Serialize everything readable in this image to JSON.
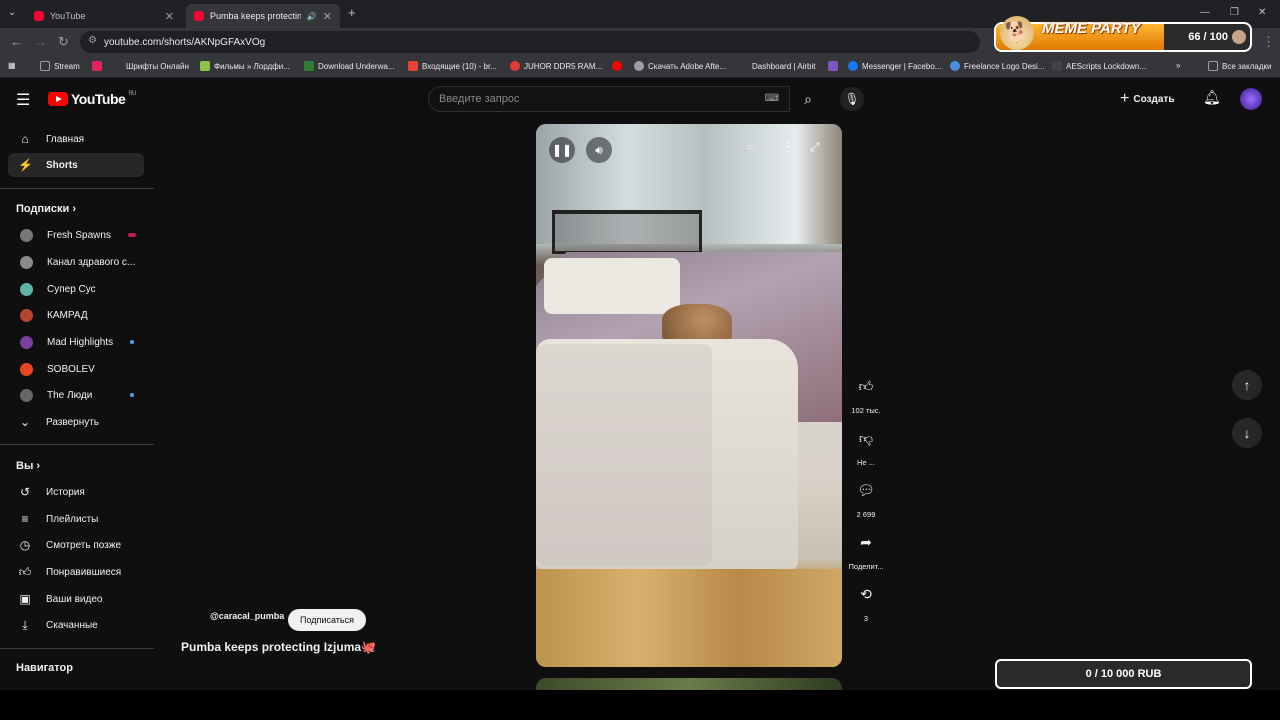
{
  "browser": {
    "tabs": [
      {
        "label": "YouTube"
      },
      {
        "label": "Pumba keeps protecting Iz"
      }
    ],
    "url": "youtube.com/shorts/AKNpGFAxVOg",
    "bookmarks": [
      {
        "label": "Stream",
        "color": "#5f6368"
      },
      {
        "label": "",
        "color": "#e0245e"
      },
      {
        "label": "Шрифты Онлайн",
        "color": "#5f6368"
      },
      {
        "label": "Фильмы » Лордфи...",
        "color": "#8bc34a"
      },
      {
        "label": "Download Underwa...",
        "color": "#2e7d32"
      },
      {
        "label": "Входящие (10) - br...",
        "color": "#ea4335"
      },
      {
        "label": "JUHOR DDR5 RAM...",
        "color": "#e53935"
      },
      {
        "label": "",
        "color": "#ff0000"
      },
      {
        "label": "Скачать Adobe Afte...",
        "color": "#9e9e9e"
      },
      {
        "label": "Dashboard | Airbit",
        "color": "#35363a"
      },
      {
        "label": "",
        "color": "#7e57c2"
      },
      {
        "label": "Messenger | Facebo...",
        "color": "#1877f2"
      },
      {
        "label": "Freelance Logo Desi...",
        "color": "#4a90d9"
      },
      {
        "label": "AEScripts Lockdown...",
        "color": "#424242"
      }
    ],
    "all_bookmarks": "Все закладки"
  },
  "meme_widget": {
    "title": "MEME PARTY",
    "count": "66 / 100",
    "progress": 0.66
  },
  "youtube": {
    "region": "RU",
    "logo_text": "YouTube",
    "search_placeholder": "Введите запрос",
    "create_label": "Создать"
  },
  "sidebar": {
    "main": [
      {
        "label": "Главная",
        "icon": "home-icon"
      },
      {
        "label": "Shorts",
        "icon": "shorts-icon",
        "selected": true
      }
    ],
    "subs_heading": "Подписки",
    "subscriptions": [
      {
        "label": "Fresh Spawns",
        "color": "#777777",
        "live": "red"
      },
      {
        "label": "Канал здравого с...",
        "color": "#8a8a8a"
      },
      {
        "label": "Супер Сус",
        "color": "#5fb3a7"
      },
      {
        "label": "КАМРАД",
        "color": "#b5462f"
      },
      {
        "label": "Mad Highlights",
        "color": "#7b3fa0",
        "live": "blue"
      },
      {
        "label": "SOBOLEV",
        "color": "#e8461f"
      },
      {
        "label": "The Люди",
        "color": "#666666",
        "live": "blue"
      }
    ],
    "expand_label": "Развернуть",
    "you_heading": "Вы",
    "you_items": [
      {
        "label": "История",
        "icon": "history-icon"
      },
      {
        "label": "Плейлисты",
        "icon": "playlists-icon"
      },
      {
        "label": "Смотреть позже",
        "icon": "watch-later-icon"
      },
      {
        "label": "Понравившиеся",
        "icon": "liked-icon"
      },
      {
        "label": "Ваши видео",
        "icon": "your-videos-icon"
      },
      {
        "label": "Скачанные",
        "icon": "downloads-icon"
      }
    ],
    "navigator_heading": "Навигатор"
  },
  "short": {
    "channel": "@caracal_pumba",
    "subscribe_label": "Подписаться",
    "title": "Pumba keeps protecting Izjuma🐙",
    "likes": "102 тыс.",
    "dislike": "Не ...",
    "comments": "2 699",
    "share": "Поделит...",
    "remix": "3"
  },
  "donation": {
    "text": "0 / 10 000 RUB"
  }
}
